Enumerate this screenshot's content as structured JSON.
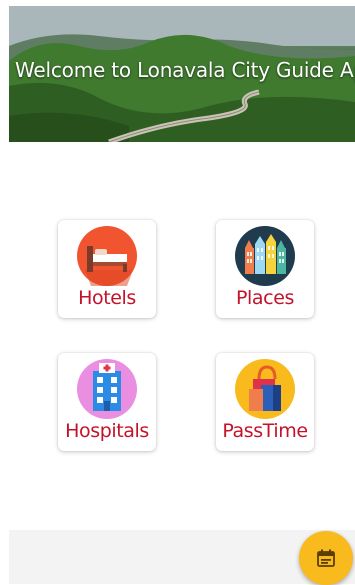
{
  "banner": {
    "title": "Welcome to Lonavala City Guide App"
  },
  "tiles": [
    {
      "label": "Hotels",
      "icon": "hotel-bed-icon",
      "color": "#f1552f"
    },
    {
      "label": "Places",
      "icon": "buildings-icon",
      "color": "#1f3b4d"
    },
    {
      "label": "Hospitals",
      "icon": "hospital-icon",
      "color": "#e98ee0"
    },
    {
      "label": "PassTime",
      "icon": "shopping-bags-icon",
      "color": "#f8ba1c"
    }
  ],
  "fab": {
    "icon": "calendar-icon",
    "color": "#f8ba1c"
  },
  "colors": {
    "label": "#c4122a",
    "bottom_bar": "#f3f3f3"
  }
}
